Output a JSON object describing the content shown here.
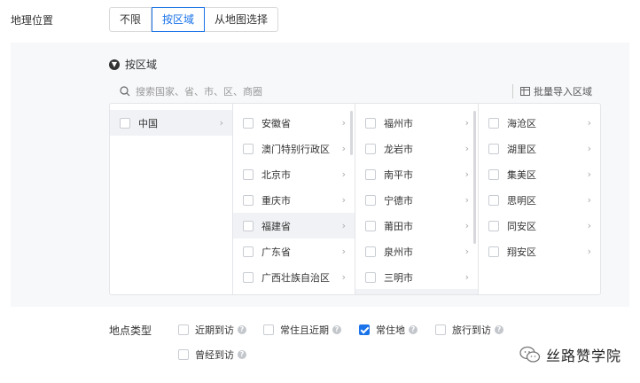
{
  "geo": {
    "label": "地理位置",
    "tabs": [
      "不限",
      "按区域",
      "从地图选择"
    ],
    "active_tab": "按区域"
  },
  "region": {
    "title": "按区域",
    "search_placeholder": "搜索国家、省、市、区、商圈",
    "batch_import": "批量导入区域"
  },
  "cascader": {
    "countries": [
      {
        "label": "中国",
        "selected": true
      }
    ],
    "provinces": [
      {
        "label": "安徽省"
      },
      {
        "label": "澳门特别行政区"
      },
      {
        "label": "北京市"
      },
      {
        "label": "重庆市"
      },
      {
        "label": "福建省",
        "selected": true
      },
      {
        "label": "广东省"
      },
      {
        "label": "广西壮族自治区"
      }
    ],
    "cities": [
      {
        "label": "福州市"
      },
      {
        "label": "龙岩市"
      },
      {
        "label": "南平市"
      },
      {
        "label": "宁德市"
      },
      {
        "label": "莆田市"
      },
      {
        "label": "泉州市"
      },
      {
        "label": "三明市"
      }
    ],
    "districts": [
      {
        "label": "海沧区"
      },
      {
        "label": "湖里区"
      },
      {
        "label": "集美区"
      },
      {
        "label": "思明区"
      },
      {
        "label": "同安区"
      },
      {
        "label": "翔安区"
      }
    ]
  },
  "location_types": {
    "label": "地点类型",
    "options": [
      {
        "label": "近期到访",
        "checked": false
      },
      {
        "label": "常住且近期",
        "checked": false
      },
      {
        "label": "常住地",
        "checked": true
      },
      {
        "label": "旅行到访",
        "checked": false
      },
      {
        "label": "曾经到访",
        "checked": false
      }
    ]
  },
  "watermark": {
    "text": "丝路赞学院",
    "icon": "wechat-icon"
  },
  "colors": {
    "accent": "#1a73e8",
    "panel_bg": "#f7f8fa",
    "border": "#e3e5e8"
  }
}
